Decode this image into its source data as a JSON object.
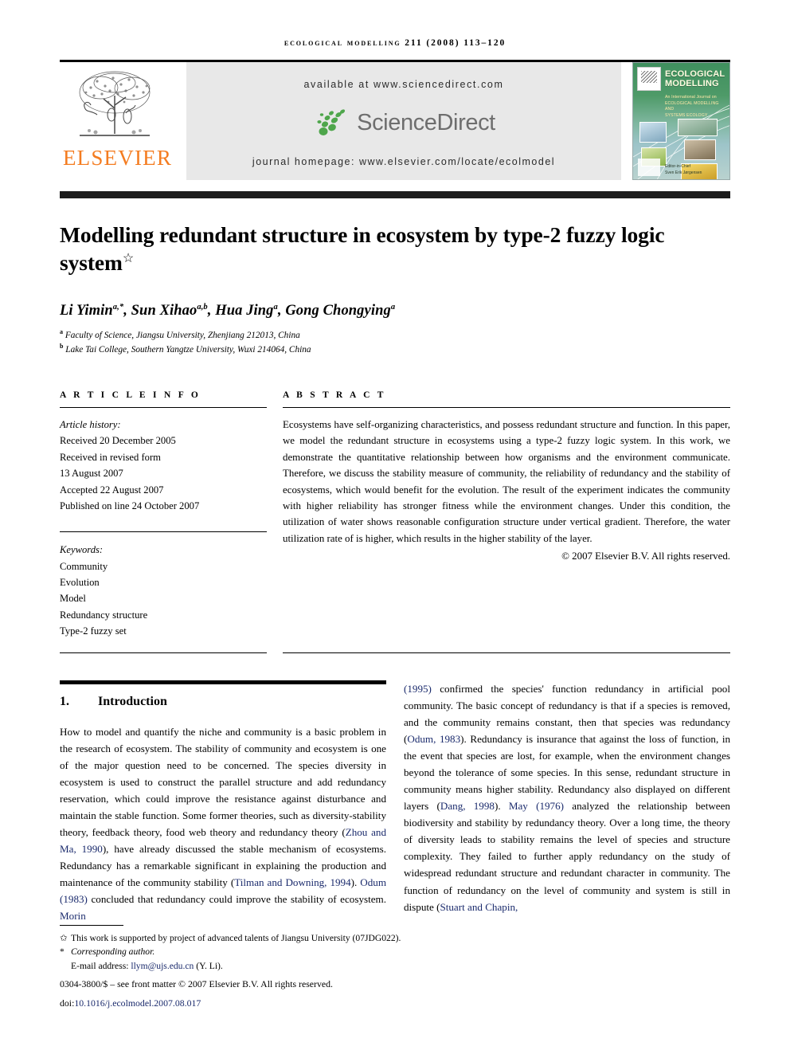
{
  "running_head": "Ecological Modelling 211 (2008) 113–120",
  "masthead": {
    "publisher_wordmark": "ELSEVIER",
    "available_at": "available at www.sciencedirect.com",
    "sciencedirect_word": "ScienceDirect",
    "journal_homepage": "journal homepage: www.elsevier.com/locate/ecolmodel",
    "cover": {
      "title_line1": "ECOLOGICAL",
      "title_line2": "MODELLING",
      "subtitle": "An International Journal on",
      "sub_line1": "ECOLOGICAL MODELLING AND",
      "sub_line2": "SYSTEMS ECOLOGY",
      "editor_label": "Editor-in-Chief",
      "editor_name": "Sven Erik Jørgensen"
    },
    "colors": {
      "elsevier_orange": "#f47c20",
      "sciencedirect_green": "#4ea64b",
      "sciencedirect_gray": "#6e6e6e",
      "band_background": "#e8e8e8",
      "cover_green": "#4e9a68"
    }
  },
  "article": {
    "title": "Modelling redundant structure in ecosystem by type-2 fuzzy logic system",
    "title_marker": "☆",
    "authors": "Li Yimin, Sun Xihao, Hua Jing, Gong Chongying",
    "author_list": [
      {
        "name": "Li Yimin",
        "sup": "a,*"
      },
      {
        "name": "Sun Xihao",
        "sup": "a,b"
      },
      {
        "name": "Hua Jing",
        "sup": "a"
      },
      {
        "name": "Gong Chongying",
        "sup": "a"
      }
    ],
    "affiliations": [
      {
        "mark": "a",
        "text": "Faculty of Science, Jiangsu University, Zhenjiang 212013, China"
      },
      {
        "mark": "b",
        "text": "Lake Tai College, Southern Yangtze University, Wuxi 214064, China"
      }
    ]
  },
  "article_info": {
    "heading": "A R T I C L E  I N F O",
    "history_label": "Article history:",
    "history": [
      "Received 20 December 2005",
      "Received in revised form",
      "13 August 2007",
      "Accepted 22 August 2007",
      "Published on line 24 October 2007"
    ],
    "keywords_label": "Keywords:",
    "keywords": [
      "Community",
      "Evolution",
      "Model",
      "Redundancy structure",
      "Type-2 fuzzy set"
    ]
  },
  "abstract": {
    "heading": "A B S T R A C T",
    "text": "Ecosystems have self-organizing characteristics, and possess redundant structure and function. In this paper, we model the redundant structure in ecosystems using a type-2 fuzzy logic system. In this work, we demonstrate the quantitative relationship between how organisms and the environment communicate. Therefore, we discuss the stability measure of community, the reliability of redundancy and the stability of ecosystems, which would benefit for the evolution. The result of the experiment indicates the community with higher reliability has stronger fitness while the environment changes. Under this condition, the utilization of water shows reasonable configuration structure under vertical gradient. Therefore, the water utilization rate of is higher, which results in the higher stability of the layer.",
    "copyright": "© 2007 Elsevier B.V. All rights reserved."
  },
  "section": {
    "number": "1.",
    "title": "Introduction"
  },
  "body": {
    "left_column_html": "How to model and quantify the niche and community is a basic problem in the research of ecosystem. The stability of community and ecosystem is one of the major question need to be concerned. The species diversity in ecosystem is used to construct the parallel structure and add redundancy reservation, which could improve the resistance against disturbance and maintain the stable function. Some former theories, such as diversity-stability theory, feedback theory, food web theory and redundancy theory (Zhou and Ma, 1990), have already discussed the stable mechanism of ecosystems. Redundancy has a remarkable significant in explaining the production and maintenance of the community stability (Tilman and Downing, 1994). Odum (1983) concluded that redundancy could improve the stability of ecosystem. Morin",
    "right_column_html": "(1995) confirmed the species' function redundancy in artificial pool community. The basic concept of redundancy is that if a species is removed, and the community remains constant, then that species was redundancy (Odum, 1983). Redundancy is insurance that against the loss of function, in the event that species are lost, for example, when the environment changes beyond the tolerance of some species. In this sense, redundant structure in community means higher stability. Redundancy also displayed on different layers (Dang, 1998). May (1976) analyzed the relationship between biodiversity and stability by redundancy theory. Over a long time, the theory of diversity leads to stability remains the level of species and structure complexity. They failed to further apply redundancy on the study of widespread redundant structure and redundant character in community. The function of redundancy on the level of community and system is still in dispute (Stuart and Chapin,",
    "citations": [
      "Zhou and Ma, 1990",
      "Tilman and Downing, 1994",
      "Odum (1983)",
      "Morin (1995)",
      "Odum, 1983",
      "Dang, 1998",
      "May (1976)",
      "Stuart and Chapin,"
    ]
  },
  "footnotes": {
    "funding_marker": "✩",
    "funding": "This work is supported by project of advanced talents of Jiangsu University (07JDG022).",
    "corresponding_marker": "*",
    "corresponding": "Corresponding author.",
    "email_label": "E-mail address:",
    "email": "llym@ujs.edu.cn",
    "email_owner": "(Y. Li).",
    "issn_line": "0304-3800/$ – see front matter © 2007 Elsevier B.V. All rights reserved.",
    "doi_label": "doi:",
    "doi": "10.1016/j.ecolmodel.2007.08.017"
  }
}
